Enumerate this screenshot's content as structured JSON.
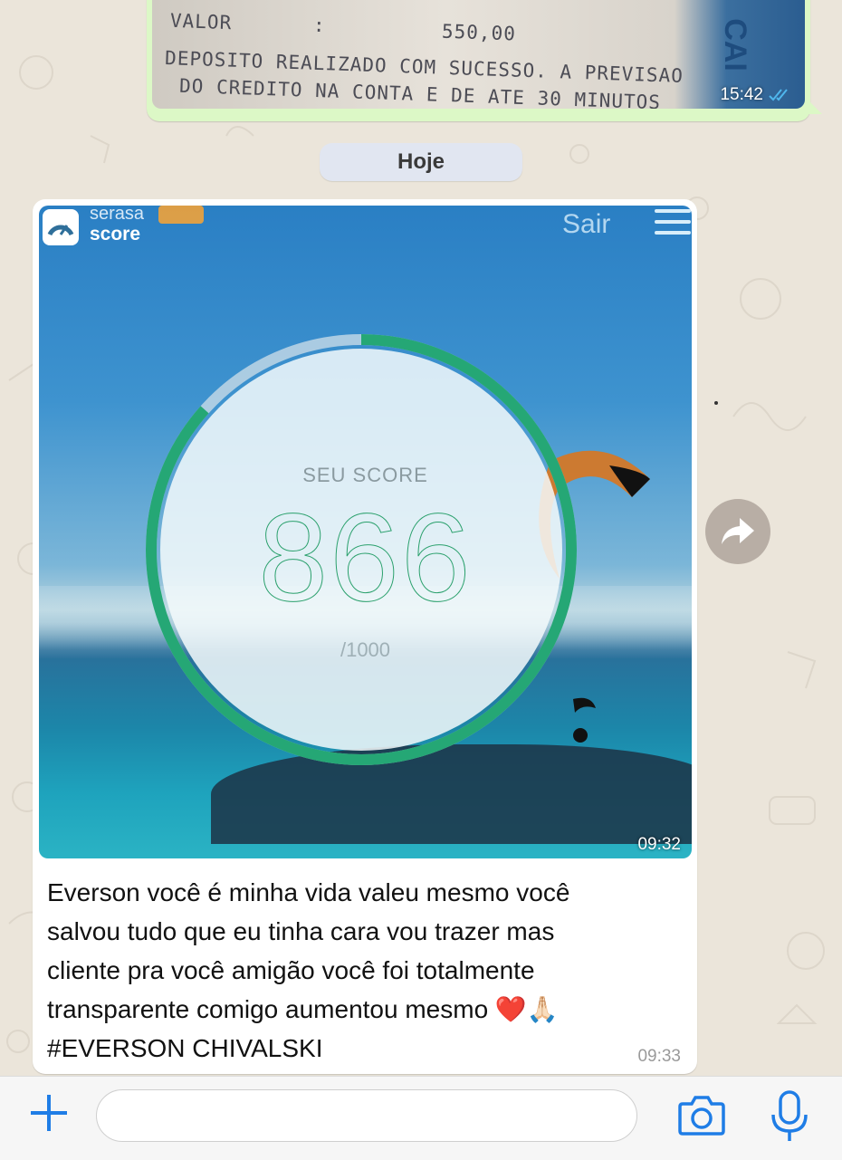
{
  "receipt": {
    "label_valor": "VALOR",
    "colon": ":",
    "value": "550,00",
    "line2": "DEPOSITO REALIZADO COM SUCESSO. A PREVISAO",
    "line3": "DO CREDITO NA CONTA E DE ATE 30 MINUTOS",
    "side_text": "CAI",
    "time": "15:42",
    "status_icon": "double-check-icon"
  },
  "date_divider": "Hoje",
  "score_image": {
    "brand_line1": "serasa",
    "brand_line2": "score",
    "sair": "Sair",
    "menu_icon": "hamburger-menu-icon",
    "label": "SEU SCORE",
    "score": "866",
    "max": "/1000",
    "score_fraction": 0.866,
    "time": "09:32"
  },
  "message": {
    "text_line1": "Everson você é minha vida valeu mesmo você",
    "text_line2": "salvou tudo que eu tinha cara vou trazer mas",
    "text_line3": "cliente pra você amigão você foi totalmente",
    "text_line4": "transparente comigo aumentou mesmo ❤️🙏🏻",
    "text_line5": "#EVERSON CHIVALSKI",
    "time": "09:33"
  },
  "share_icon": "forward-arrow-icon",
  "input_bar": {
    "plus_icon": "plus-icon",
    "placeholder": "",
    "camera_icon": "camera-icon",
    "mic_icon": "microphone-icon",
    "accent": "#1f7de6"
  }
}
